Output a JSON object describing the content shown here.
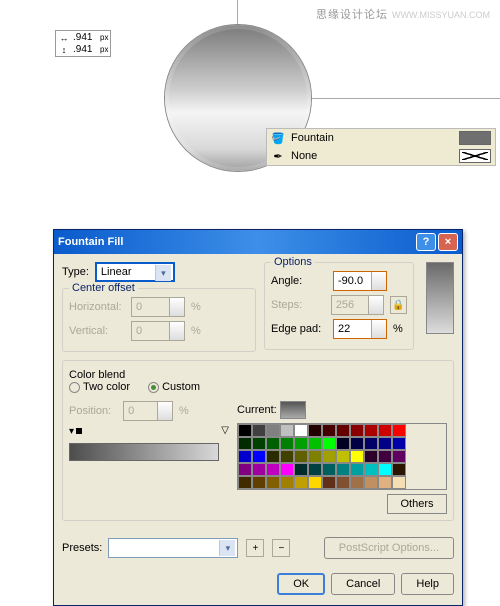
{
  "watermark": {
    "text": "思缘设计论坛",
    "url": "WWW.MISSYUAN.COM"
  },
  "dimensions": {
    "width_val": ".941",
    "width_unit": "px",
    "height_val": ".941",
    "height_unit": "px"
  },
  "fill_strip": {
    "fill_label": "Fountain",
    "outline_label": "None"
  },
  "dialog": {
    "title": "Fountain Fill",
    "type_label": "Type:",
    "type_value": "Linear",
    "center_offset": {
      "legend": "Center offset",
      "horiz_label": "Horizontal:",
      "horiz_val": "0",
      "vert_label": "Vertical:",
      "vert_val": "0"
    },
    "options": {
      "legend": "Options",
      "angle_label": "Angle:",
      "angle_val": "-90.0",
      "steps_label": "Steps:",
      "steps_val": "256",
      "edge_label": "Edge pad:",
      "edge_val": "22"
    },
    "colorblend": {
      "legend": "Color blend",
      "two_color": "Two color",
      "custom": "Custom",
      "position_label": "Position:",
      "position_val": "0",
      "current_label": "Current:",
      "others": "Others"
    },
    "presets_label": "Presets:",
    "ps_options": "PostScript Options...",
    "buttons": {
      "ok": "OK",
      "cancel": "Cancel",
      "help": "Help"
    },
    "pct": "%"
  },
  "palette": [
    "#000",
    "#404040",
    "#808080",
    "#c0c0c0",
    "#fff",
    "#200",
    "#400",
    "#600",
    "#800",
    "#a00",
    "#c00",
    "#f00",
    "#002b00",
    "#004000",
    "#006000",
    "#008000",
    "#00a000",
    "#00c000",
    "#00ff00",
    "#002",
    "#004",
    "#006",
    "#008",
    "#00a",
    "#00c",
    "#00f",
    "#2b2b00",
    "#404000",
    "#606000",
    "#808000",
    "#a0a000",
    "#c0c000",
    "#ffff00",
    "#2b002b",
    "#400040",
    "#600060",
    "#800080",
    "#a000a0",
    "#c000c0",
    "#ff00ff",
    "#002b2b",
    "#004040",
    "#006060",
    "#008080",
    "#00a0a0",
    "#00c0c0",
    "#00ffff",
    "#2b1500",
    "#402b00",
    "#604000",
    "#806000",
    "#a08000",
    "#c0a000",
    "#ffd700",
    "#603018",
    "#805030",
    "#a07048",
    "#c09060",
    "#e0b080",
    "#f5deb3"
  ]
}
